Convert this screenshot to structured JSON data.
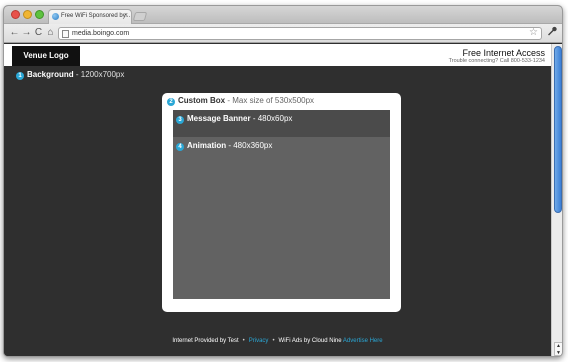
{
  "browser": {
    "tab_title": "Free WiFi Sponsored by...",
    "tab_close": "×",
    "url": "media.boingo.com",
    "nav": {
      "back": "←",
      "forward": "→",
      "reload": "C",
      "home": "⌂"
    },
    "star": "☆",
    "wrench": "🔧"
  },
  "header": {
    "logo": "Venue Logo",
    "title": "Free Internet Access",
    "subtitle": "Trouble connecting? Call 800-533-1234"
  },
  "regions": {
    "background": {
      "num": "1",
      "name": "Background",
      "size": " - 1200x700px"
    },
    "custom_box": {
      "num": "2",
      "name": "Custom Box",
      "size": " - Max size of 530x500px"
    },
    "banner": {
      "num": "3",
      "name": "Message Banner",
      "size": " - 480x60px"
    },
    "animation": {
      "num": "4",
      "name": "Animation",
      "size": " - 480x360px"
    }
  },
  "footer": {
    "provided": "Internet Provided by Test",
    "sep": "•",
    "privacy": "Privacy",
    "ads": "WiFi Ads by Cloud Nine",
    "advertise": "Advertise Here"
  },
  "colors": {
    "accent": "#2aa7d6",
    "page_bg": "#2f2f2f",
    "banner": "#4b4b4b",
    "animation": "#626262"
  }
}
